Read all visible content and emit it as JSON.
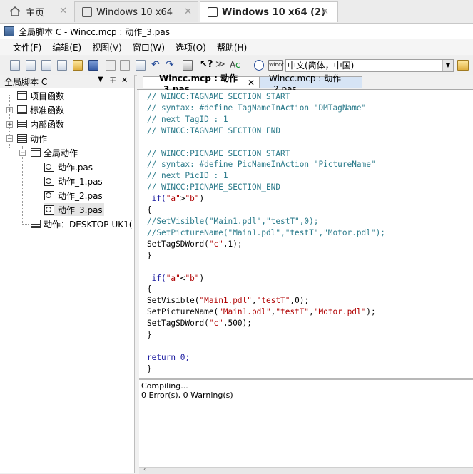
{
  "vm_tabs": [
    {
      "label": "主页",
      "icon": "home-icon"
    },
    {
      "label": "Windows 10 x64",
      "icon": "vm-icon"
    },
    {
      "label": "Windows 10 x64 (2)",
      "icon": "vm-icon",
      "active": true
    }
  ],
  "window_title": "全局脚本 C - Wincc.mcp : 动作_3.pas",
  "menu": [
    "文件(F)",
    "编辑(E)",
    "视图(V)",
    "窗口(W)",
    "选项(O)",
    "帮助(H)"
  ],
  "toolbar": {
    "icons": [
      "new-icon",
      "doc-icon",
      "doc2-icon",
      "doc3-icon",
      "open-icon",
      "save-icon",
      "cut-icon",
      "copy-icon",
      "paste-icon",
      "undo-icon",
      "redo-icon",
      "print-icon",
      "help-pointer-icon",
      "compile-icon",
      "color-text-icon",
      "timer-icon",
      "tag-icon"
    ],
    "language": "中文(简体，中国)",
    "tag_text": "Wincc"
  },
  "left_panel": {
    "title": "全局脚本 C",
    "pin": "∓",
    "close": "✕",
    "tree": [
      {
        "label": "项目函数"
      },
      {
        "label": "标准函数"
      },
      {
        "label": "内部函数"
      },
      {
        "label": "动作"
      },
      {
        "label": "全局动作"
      },
      {
        "label": "动作.pas"
      },
      {
        "label": "动作_1.pas"
      },
      {
        "label": "动作_2.pas"
      },
      {
        "label": "动作_3.pas"
      },
      {
        "label": "动作：DESKTOP-UK1("
      }
    ]
  },
  "editor_tabs": [
    {
      "label": "Wincc.mcp : 动作_3.pas",
      "close": "✕"
    },
    {
      "label": "Wincc.mcp : 动作_2.pas"
    }
  ],
  "code_lines": [
    "// WINCC:TAGNAME_SECTION_START",
    "// syntax: #define TagNameInAction \"DMTagName\"",
    "// next TagID : 1",
    "// WINCC:TAGNAME_SECTION_END",
    "",
    "// WINCC:PICNAME_SECTION_START",
    "// syntax: #define PicNameInAction \"PictureName\"",
    "// next PicID : 1",
    "// WINCC:PICNAME_SECTION_END",
    " if(\"a\">\"b\")",
    "{",
    "//SetVisible(\"Main1.pdl\",\"testT\",0);",
    "//SetPictureName(\"Main1.pdl\",\"testT\",\"Motor.pdl\");",
    "SetTagSDWord(\"c\",1);",
    "}",
    "",
    " if(\"a\"<\"b\")",
    "{",
    "SetVisible(\"Main1.pdl\",\"testT\",0);",
    "SetPictureName(\"Main1.pdl\",\"testT\",\"Motor.pdl\");",
    "SetTagSDWord(\"c\",500);",
    "}",
    "",
    "return 0;",
    "}"
  ],
  "output": {
    "line1": "Compiling...",
    "line2": " 0 Error(s), 0 Warning(s)"
  },
  "colors": {
    "comment": "#2a7a8a",
    "string": "#b00000",
    "keyword": "#1a1aa0"
  }
}
